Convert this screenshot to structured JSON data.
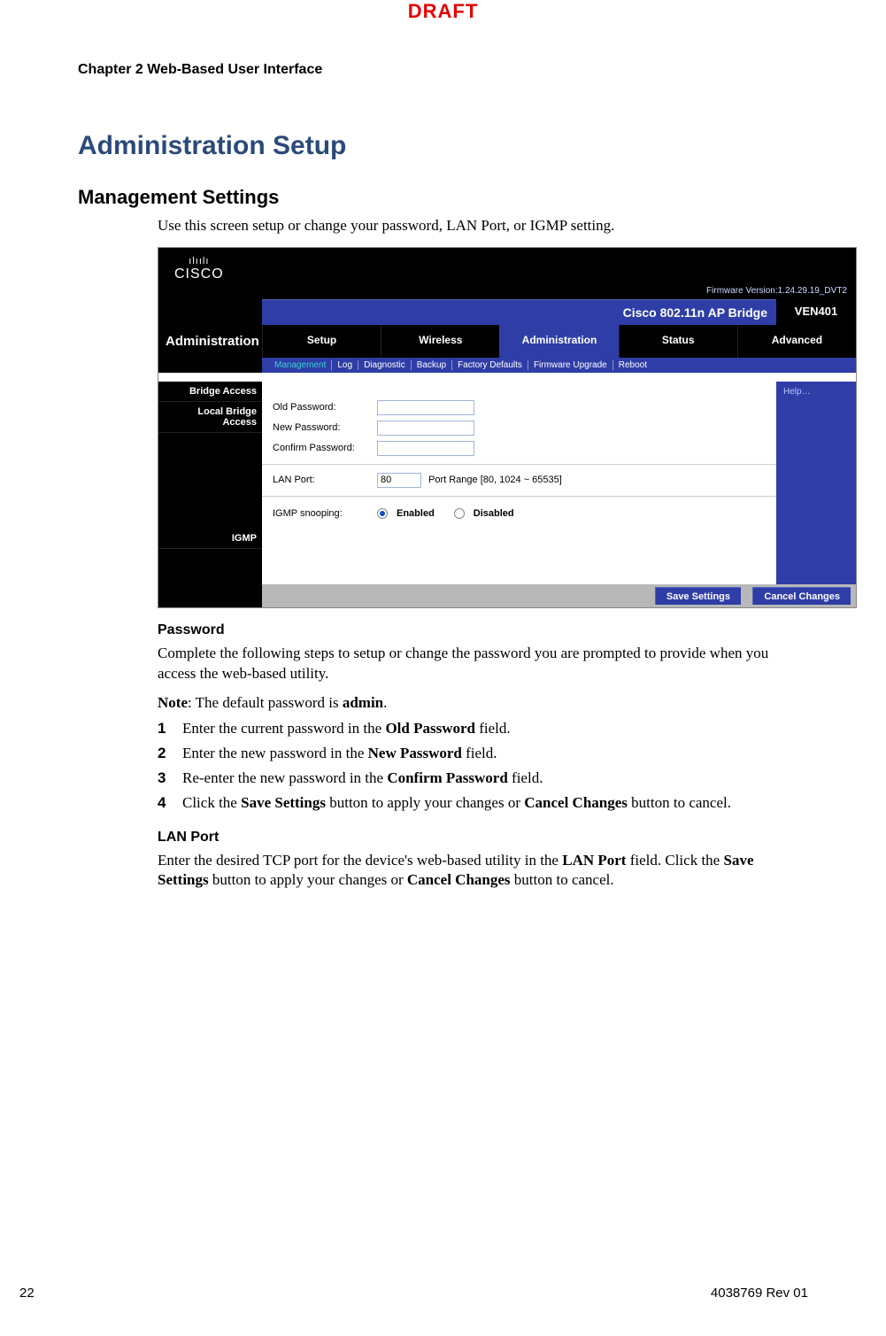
{
  "draft": "DRAFT",
  "chapter": "Chapter 2    Web-Based User Interface",
  "h1": "Administration Setup",
  "h2": "Management Settings",
  "intro": "Use this screen setup or change your password, LAN Port, or IGMP setting.",
  "screenshot": {
    "logo_bars": "ılıılı",
    "logo_cisco": "CISCO",
    "firmware": "Firmware Version:1.24.29.19_DVT2",
    "product_title": "Cisco 802.11n AP Bridge",
    "model": "VEN401",
    "section": "Administration",
    "tabs": [
      "Setup",
      "Wireless",
      "Administration",
      "Status",
      "Advanced"
    ],
    "subtabs": [
      "Management",
      "Log",
      "Diagnostic",
      "Backup",
      "Factory Defaults",
      "Firmware Upgrade",
      "Reboot"
    ],
    "side": {
      "bridge_access": "Bridge Access",
      "local_bridge_access": "Local Bridge Access",
      "igmp": "IGMP"
    },
    "labels": {
      "old_pw": "Old Password:",
      "new_pw": "New Password:",
      "confirm_pw": "Confirm Password:",
      "lan_port": "LAN Port:",
      "lan_port_value": "80",
      "lan_port_hint": "Port Range [80, 1024 ~ 65535]",
      "igmp_snooping": "IGMP snooping:",
      "enabled": "Enabled",
      "disabled": "Disabled"
    },
    "help": "Help…",
    "save": "Save Settings",
    "cancel": "Cancel Changes"
  },
  "password": {
    "heading": "Password",
    "p1": "Complete the following steps to setup or change the password you are prompted to provide when you access the web-based utility.",
    "note_prefix": "Note",
    "note_text": ": The default password is ",
    "note_pw": "admin",
    "note_end": ".",
    "steps": [
      {
        "n": "1",
        "pre": "Enter the current password in the ",
        "b": "Old Password",
        "post": " field."
      },
      {
        "n": "2",
        "pre": "Enter the new password in the ",
        "b": "New Password",
        "post": " field."
      },
      {
        "n": "3",
        "pre": "Re-enter the new password in the ",
        "b": "Confirm Password",
        "post": " field."
      },
      {
        "n": "4",
        "pre": "Click the ",
        "b": "Save Settings",
        "mid": " button to apply your changes or ",
        "b2": "Cancel Changes",
        "post": " button to cancel."
      }
    ]
  },
  "lanport": {
    "heading": "LAN Port",
    "pre": "Enter the desired TCP port for the device's web-based utility  in the ",
    "b1": "LAN Port",
    "mid1": " field. Click the ",
    "b2": "Save Settings",
    "mid2": " button to apply your changes or ",
    "b3": "Cancel Changes",
    "post": " button to cancel."
  },
  "footer": {
    "page": "22",
    "doc": "4038769 Rev 01"
  }
}
